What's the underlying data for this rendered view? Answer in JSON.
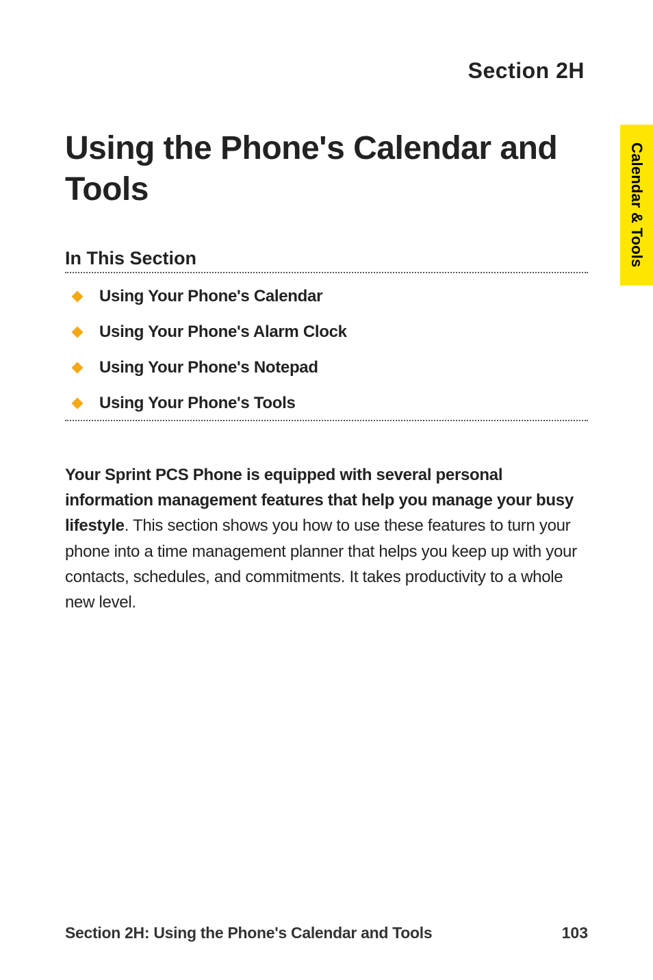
{
  "section_label": "Section 2H",
  "main_title": "Using the Phone's Calendar and Tools",
  "subsection_heading": "In This Section",
  "bullets": [
    "Using Your Phone's Calendar",
    "Using Your Phone's Alarm Clock",
    "Using Your Phone's Notepad",
    "Using Your Phone's Tools"
  ],
  "paragraph": {
    "bold_lead": "Your Sprint PCS Phone is equipped with several personal information management features that help you manage your busy lifestyle",
    "rest": ". This section shows you how to use these features to turn your phone into a time management planner that helps you keep up with your contacts, schedules, and commitments. It takes productivity to a whole new level."
  },
  "side_tab": "Calendar & Tools",
  "footer": {
    "title": "Section 2H: Using the Phone's Calendar and Tools",
    "page_number": "103"
  }
}
